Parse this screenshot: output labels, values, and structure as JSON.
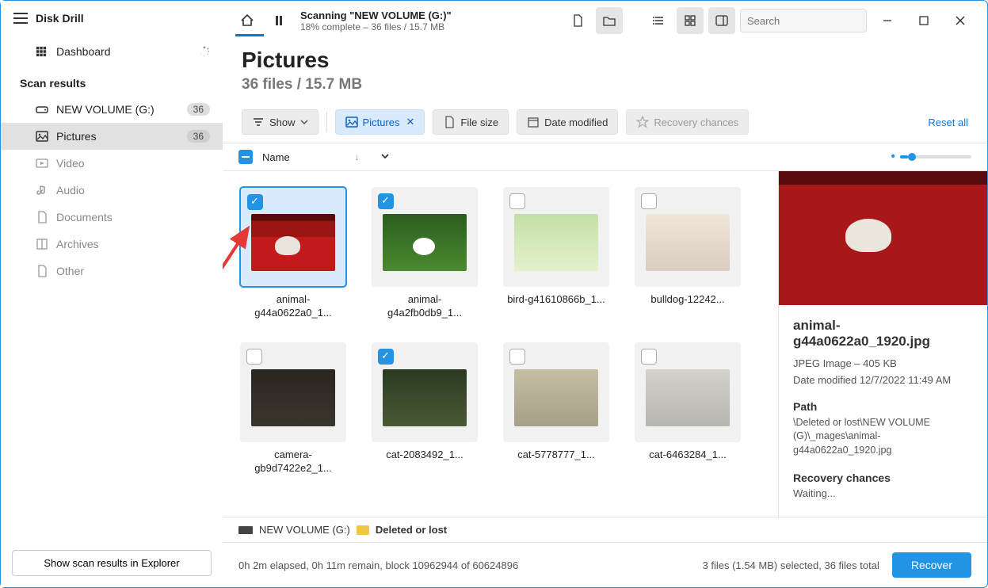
{
  "app": {
    "title": "Disk Drill"
  },
  "sidebar": {
    "dashboard": "Dashboard",
    "scan_results_label": "Scan results",
    "items": [
      {
        "label": "NEW VOLUME (G:)",
        "count": "36"
      },
      {
        "label": "Pictures",
        "count": "36"
      },
      {
        "label": "Video"
      },
      {
        "label": "Audio"
      },
      {
        "label": "Documents"
      },
      {
        "label": "Archives"
      },
      {
        "label": "Other"
      }
    ],
    "explorer_btn": "Show scan results in Explorer"
  },
  "titlebar": {
    "scan_title": "Scanning \"NEW VOLUME (G:)\"",
    "scan_sub": "18% complete – 36 files / 15.7 MB",
    "search_placeholder": "Search"
  },
  "header": {
    "title": "Pictures",
    "subtitle": "36 files / 15.7 MB"
  },
  "filters": {
    "show": "Show",
    "pictures": "Pictures",
    "file_size": "File size",
    "date_modified": "Date modified",
    "recovery_chances": "Recovery chances",
    "reset": "Reset all"
  },
  "list_header": {
    "name": "Name"
  },
  "files": [
    {
      "name": "animal-g44a0622a0_1...",
      "selected": true,
      "focused": true,
      "thumb": "img-dog-red"
    },
    {
      "name": "animal-g4a2fb0db9_1...",
      "selected": true,
      "thumb": "img-dog-grass"
    },
    {
      "name": "bird-g41610866b_1...",
      "selected": false,
      "thumb": "img-bird"
    },
    {
      "name": "bulldog-12242...",
      "selected": false,
      "thumb": "img-bulldog"
    },
    {
      "name": "camera-gb9d7422e2_1...",
      "selected": false,
      "thumb": "img-camera"
    },
    {
      "name": "cat-2083492_1...",
      "selected": true,
      "thumb": "img-cat1"
    },
    {
      "name": "cat-5778777_1...",
      "selected": false,
      "thumb": "img-cat2"
    },
    {
      "name": "cat-6463284_1...",
      "selected": false,
      "thumb": "img-cat3"
    }
  ],
  "preview": {
    "filename": "animal-g44a0622a0_1920.jpg",
    "type_size": "JPEG Image – 405 KB",
    "date_modified": "Date modified 12/7/2022 11:49 AM",
    "path_label": "Path",
    "path": "\\Deleted or lost\\NEW VOLUME (G)\\_mages\\animal-g44a0622a0_1920.jpg",
    "recovery_label": "Recovery chances",
    "recovery_status": "Waiting..."
  },
  "breadcrumb": {
    "drive": "NEW VOLUME (G:)",
    "folder": "Deleted or lost"
  },
  "status": {
    "progress": "0h 2m elapsed, 0h 11m remain, block 10962944 of 60624896",
    "selection": "3 files (1.54 MB) selected, 36 files total",
    "recover_btn": "Recover"
  }
}
